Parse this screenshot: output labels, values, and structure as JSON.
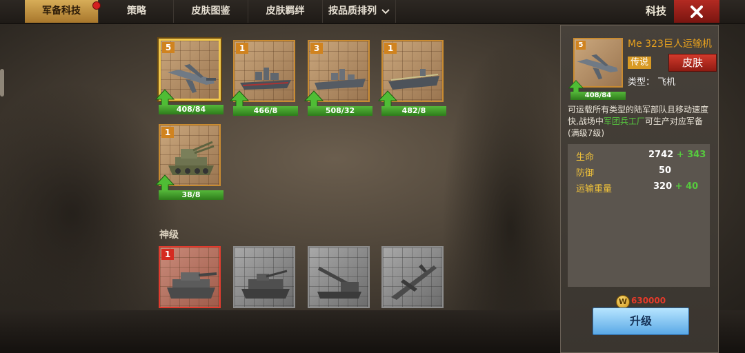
{
  "tabs": [
    {
      "label": "军备科技",
      "active": true,
      "badge": true
    },
    {
      "label": "策略",
      "active": false
    },
    {
      "label": "皮肤图鉴",
      "active": false
    },
    {
      "label": "皮肤羁绊",
      "active": false
    }
  ],
  "sort_dropdown": {
    "label": "按品质排列"
  },
  "header": {
    "title": "科技"
  },
  "cards": [
    {
      "level": "5",
      "progress": "408/84",
      "unit": "plane-transport"
    },
    {
      "level": "1",
      "progress": "466/8",
      "unit": "ship-battleship"
    },
    {
      "level": "3",
      "progress": "508/32",
      "unit": "ship-cruiser"
    },
    {
      "level": "1",
      "progress": "482/8",
      "unit": "ship-carrier"
    },
    {
      "level": "1",
      "progress": "38/8",
      "unit": "tank-aa"
    }
  ],
  "section": {
    "label": "神级"
  },
  "god_cards": [
    {
      "level": "1",
      "unit": "tank-heavy"
    },
    {
      "unit": "tank-destroyer"
    },
    {
      "unit": "artillery"
    },
    {
      "unit": "jet-plane"
    }
  ],
  "detail": {
    "name": "Me 323巨人运输机",
    "level": "5",
    "progress": "408/84",
    "rarity": "传说",
    "skin_button": "皮肤",
    "type_text": "类型：  飞机",
    "desc_1": "可运载所有类型的陆军部队且移动速度快,战场中",
    "desc_highlight": "军团兵工厂",
    "desc_2": "可生产对应军备(满级7级)",
    "stats": [
      {
        "label": "生命",
        "value": "2742",
        "bonus": "+ 343"
      },
      {
        "label": "防御",
        "value": "50",
        "bonus": ""
      },
      {
        "label": "运输重量",
        "value": "320",
        "bonus": "+ 40"
      }
    ],
    "coin_symbol": "W",
    "cost": "630000",
    "upgrade_button": "升级"
  },
  "colors": {
    "accent": "#d7ad58",
    "close": "#b32a22",
    "progress": "#3f9a28",
    "rarity": "#d89a24"
  }
}
